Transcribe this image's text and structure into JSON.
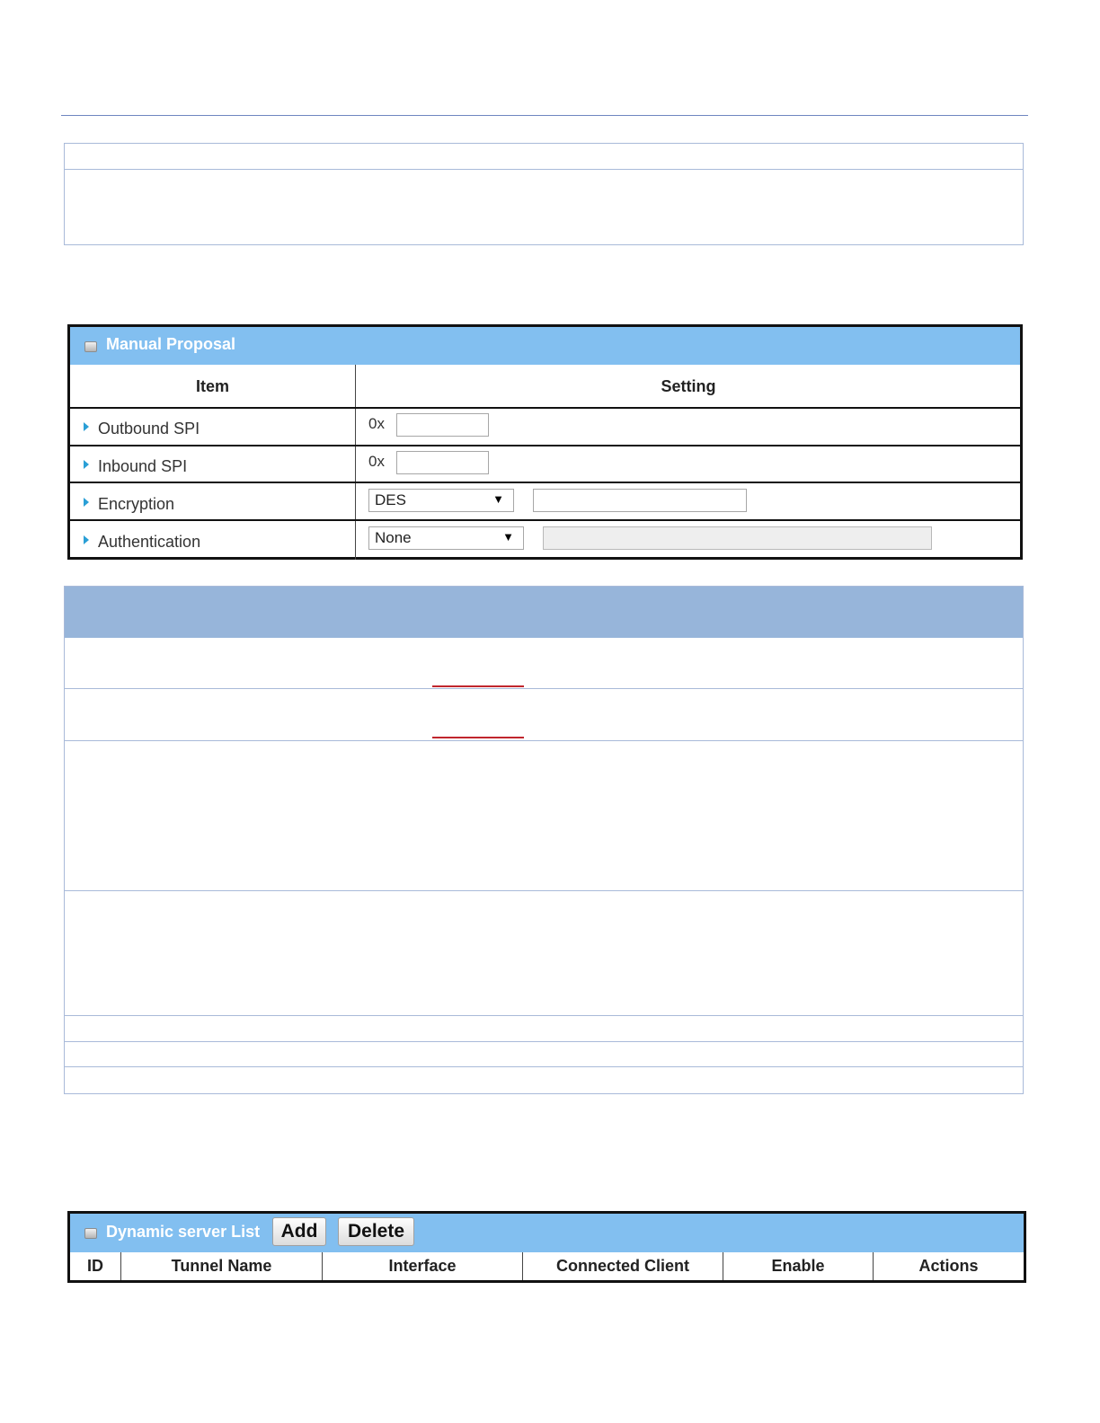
{
  "manual_proposal": {
    "title": "Manual Proposal",
    "columns": {
      "item": "Item",
      "setting": "Setting"
    },
    "rows": [
      {
        "label": "Outbound SPI",
        "prefix": "0x",
        "value": ""
      },
      {
        "label": "Inbound SPI",
        "prefix": "0x",
        "value": ""
      },
      {
        "label": "Encryption",
        "selected": "DES",
        "key_value": ""
      },
      {
        "label": "Authentication",
        "selected": "None",
        "key_value": ""
      }
    ],
    "dropdown_arrow": "▼"
  },
  "dynamic_server_list": {
    "title": "Dynamic server List",
    "add_label": "Add",
    "delete_label": "Delete",
    "columns": [
      "ID",
      "Tunnel Name",
      "Interface",
      "Connected Client",
      "Enable",
      "Actions"
    ]
  }
}
